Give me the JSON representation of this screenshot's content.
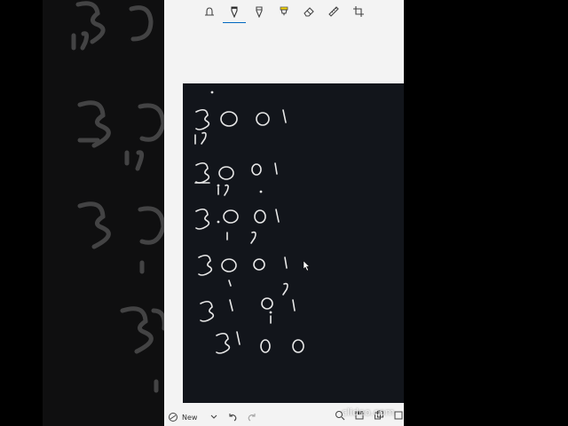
{
  "toolbar": {
    "tools": [
      "touch-writing",
      "ballpoint-pen",
      "pencil",
      "highlighter",
      "eraser",
      "ruler",
      "crop"
    ]
  },
  "bottombar": {
    "new_label": "New"
  },
  "watermark": {
    "text": "clideo.com"
  },
  "colors": {
    "ink": "#e8e8e8",
    "canvas": "#12151b",
    "toolbar_bg": "#f3f3f3",
    "accent": "#0067c0",
    "highlighter": "#f5d400"
  }
}
